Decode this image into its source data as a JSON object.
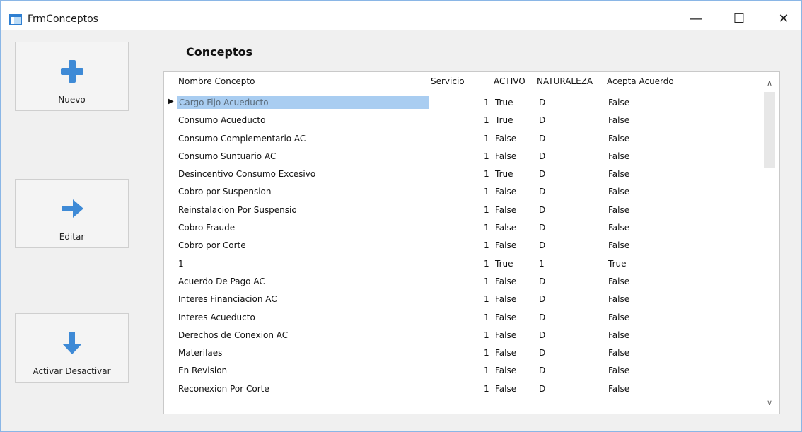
{
  "window": {
    "title": "FrmConceptos",
    "minimize_glyph": "—",
    "maximize_glyph": "☐",
    "close_glyph": "✕"
  },
  "toolbar": {
    "nuevo_label": "Nuevo",
    "editar_label": "Editar",
    "activar_label": "Activar Desactivar"
  },
  "section": {
    "title": "Conceptos"
  },
  "grid": {
    "headers": {
      "nombre": "Nombre Concepto",
      "servicio": "Servicio",
      "activo": "ACTIVO",
      "naturaleza": "NATURALEZA",
      "acepta": "Acepta Acuerdo"
    },
    "row_indicator": "▶",
    "scroll_up": "∧",
    "scroll_down": "∨",
    "rows": [
      {
        "nombre": "Cargo Fijo Acueducto",
        "servicio": "1",
        "activo": "True",
        "naturaleza": "D",
        "acepta": "False"
      },
      {
        "nombre": "Consumo Acueducto",
        "servicio": "1",
        "activo": "True",
        "naturaleza": "D",
        "acepta": "False"
      },
      {
        "nombre": "Consumo Complementario AC",
        "servicio": "1",
        "activo": "False",
        "naturaleza": "D",
        "acepta": "False"
      },
      {
        "nombre": "Consumo Suntuario AC",
        "servicio": "1",
        "activo": "False",
        "naturaleza": "D",
        "acepta": "False"
      },
      {
        "nombre": "Desincentivo Consumo Excesivo",
        "servicio": "1",
        "activo": "True",
        "naturaleza": "D",
        "acepta": "False"
      },
      {
        "nombre": "Cobro por Suspension",
        "servicio": "1",
        "activo": "False",
        "naturaleza": "D",
        "acepta": "False"
      },
      {
        "nombre": "Reinstalacion Por Suspensio",
        "servicio": "1",
        "activo": "False",
        "naturaleza": "D",
        "acepta": "False"
      },
      {
        "nombre": "Cobro Fraude",
        "servicio": "1",
        "activo": "False",
        "naturaleza": "D",
        "acepta": "False"
      },
      {
        "nombre": "Cobro por Corte",
        "servicio": "1",
        "activo": "False",
        "naturaleza": "D",
        "acepta": "False"
      },
      {
        "nombre": "1",
        "servicio": "1",
        "activo": "True",
        "naturaleza": "1",
        "acepta": "True"
      },
      {
        "nombre": "Acuerdo De Pago AC",
        "servicio": "1",
        "activo": "False",
        "naturaleza": "D",
        "acepta": "False"
      },
      {
        "nombre": "Interes Financiacion AC",
        "servicio": "1",
        "activo": "False",
        "naturaleza": "D",
        "acepta": "False"
      },
      {
        "nombre": "Interes Acueducto",
        "servicio": "1",
        "activo": "False",
        "naturaleza": "D",
        "acepta": "False"
      },
      {
        "nombre": "Derechos de Conexion AC",
        "servicio": "1",
        "activo": "False",
        "naturaleza": "D",
        "acepta": "False"
      },
      {
        "nombre": "Materilaes",
        "servicio": "1",
        "activo": "False",
        "naturaleza": "D",
        "acepta": "False"
      },
      {
        "nombre": "En Revision",
        "servicio": "1",
        "activo": "False",
        "naturaleza": "D",
        "acepta": "False"
      },
      {
        "nombre": "Reconexion Por Corte",
        "servicio": "1",
        "activo": "False",
        "naturaleza": "D",
        "acepta": "False"
      }
    ]
  }
}
